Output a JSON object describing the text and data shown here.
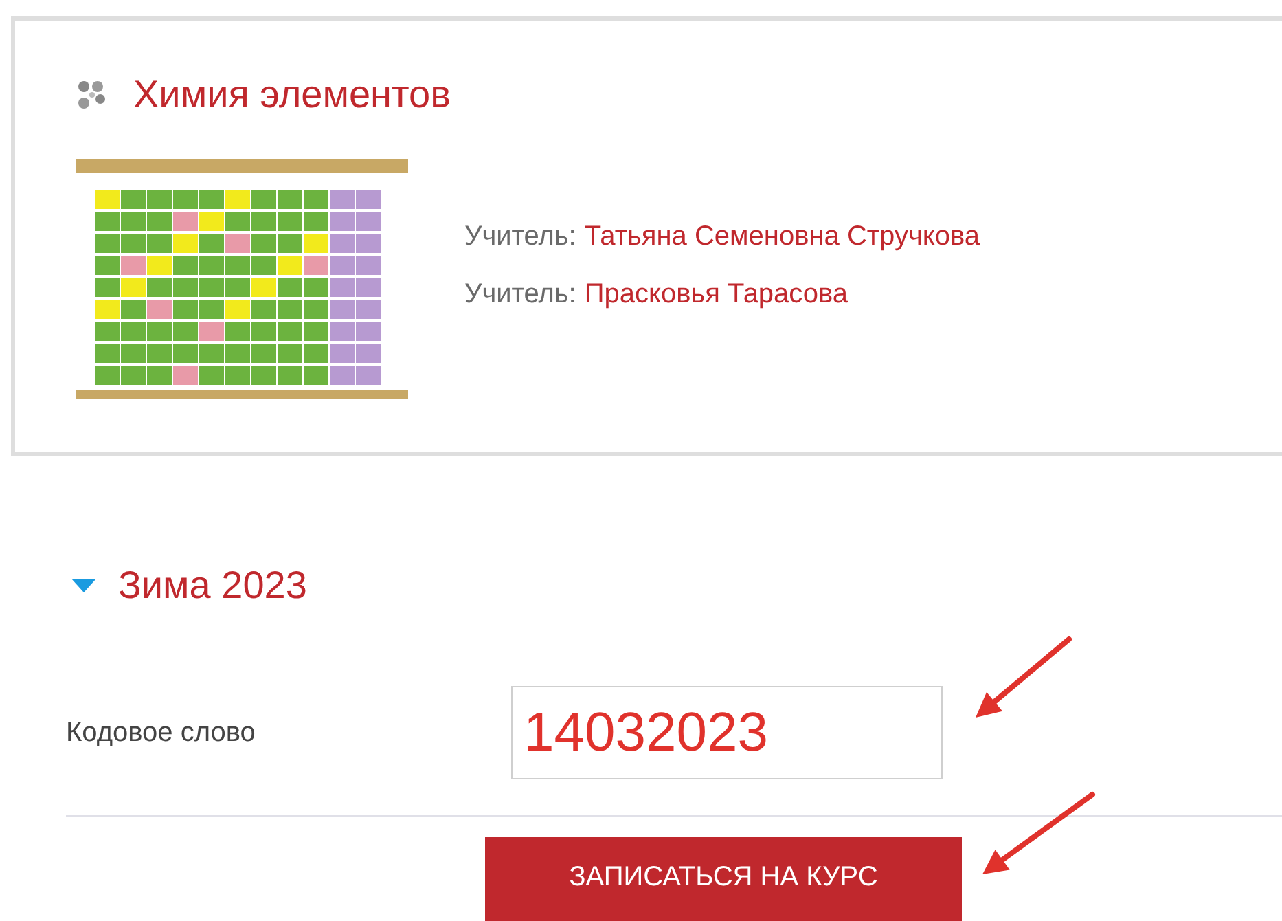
{
  "course": {
    "title": "Химия элементов",
    "teachers": [
      {
        "label": "Учитель:",
        "name": "Татьяна Семеновна Стручкова"
      },
      {
        "label": "Учитель:",
        "name": "Прасковья Тарасова"
      }
    ]
  },
  "enrolment": {
    "section": {
      "title": "Зима 2023",
      "expanded": true
    },
    "field": {
      "label": "Кодовое слово",
      "value": "14032023"
    },
    "button": "ЗАПИСАТЬСЯ НА КУРС"
  }
}
